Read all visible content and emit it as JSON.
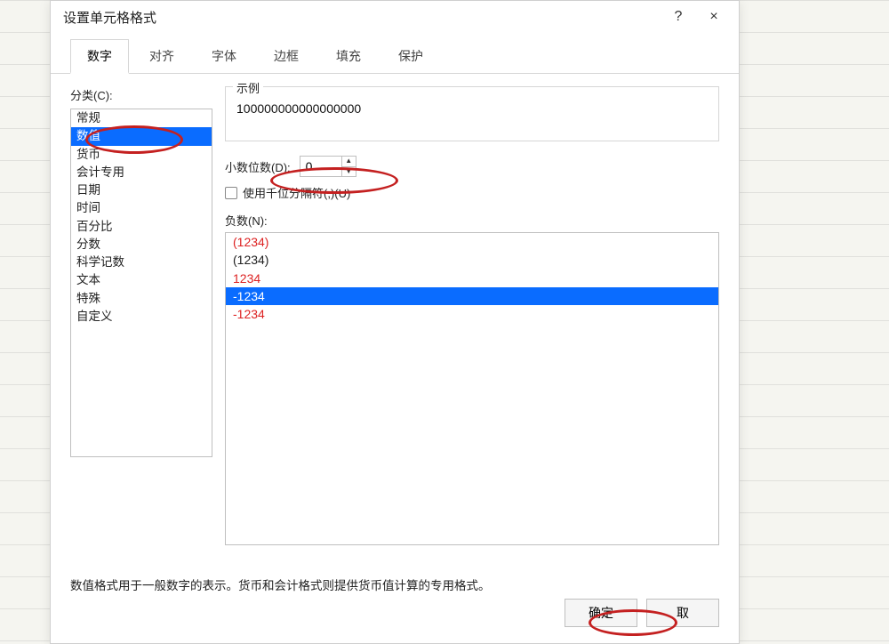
{
  "dialog": {
    "title": "设置单元格格式",
    "help": "?",
    "close": "×"
  },
  "tabs": [
    "数字",
    "对齐",
    "字体",
    "边框",
    "填充",
    "保护"
  ],
  "active_tab": 0,
  "category_label": "分类(C):",
  "categories": [
    "常规",
    "数值",
    "货币",
    "会计专用",
    "日期",
    "时间",
    "百分比",
    "分数",
    "科学记数",
    "文本",
    "特殊",
    "自定义"
  ],
  "selected_category_index": 1,
  "sample": {
    "label": "示例",
    "value": "100000000000000000"
  },
  "decimal": {
    "label": "小数位数(D):",
    "value": "0"
  },
  "thousands": {
    "label": "使用千位分隔符(,)(U)",
    "checked": false
  },
  "negative": {
    "label": "负数(N):",
    "items": [
      {
        "text": "(1234)",
        "color": "#d22"
      },
      {
        "text": "(1234)",
        "color": "#222"
      },
      {
        "text": "1234",
        "color": "#d22"
      },
      {
        "text": "-1234",
        "color": "#222"
      },
      {
        "text": "-1234",
        "color": "#d22"
      }
    ],
    "selected_index": 3
  },
  "description": "数值格式用于一般数字的表示。货币和会计格式则提供货币值计算的专用格式。",
  "buttons": {
    "ok": "确定",
    "cancel": "取"
  }
}
